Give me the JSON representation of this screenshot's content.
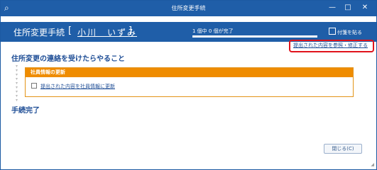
{
  "window": {
    "title": "住所変更手続",
    "minimize_glyph": "—",
    "maximize_glyph": "□",
    "close_glyph": "✕"
  },
  "header": {
    "procedure_name": "住所変更手続",
    "bracket_open": "[",
    "employee_name": "小川　いずみ",
    "bracket_close": "]",
    "progress_text": "1 個中 0 個が完了",
    "progress_done": 0,
    "progress_total": 1,
    "note_button": "付箋を貼る"
  },
  "edit_link": "提出された内容を参照・修正する",
  "section": {
    "title": "住所変更の連絡を受けたらやること",
    "task": {
      "heading": "社員情報の更新",
      "item_label": "提出された内容を社員情報に更新",
      "checked": false
    }
  },
  "completion_title": "手続完了",
  "close_button": "閉じる(C)",
  "colors": {
    "title_bar": "#1f5ea8",
    "accent_orange": "#ef8c00",
    "highlight_red": "#e0131c",
    "link_blue": "#1f4e96"
  }
}
